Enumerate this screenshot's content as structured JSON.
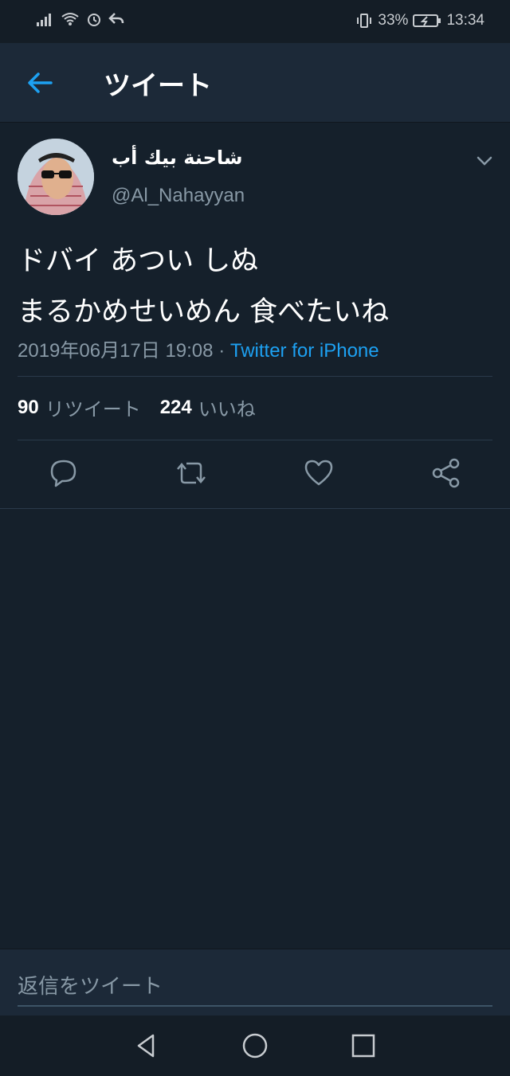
{
  "status_bar": {
    "battery": "33%",
    "time": "13:34"
  },
  "header": {
    "title": "ツイート",
    "back_icon": "arrow-left-icon"
  },
  "tweet": {
    "display_name": "شاحنة بيك أب",
    "screen_name": "@Al_Nahayyan",
    "text_line1": "ドバイ あつい しぬ",
    "text_line2": "まるかめせいめん 食べたいね",
    "timestamp": "2019年06月17日 19:08",
    "separator": "·",
    "source": "Twitter for iPhone",
    "retweets_count": "90",
    "retweets_label": "リツイート",
    "likes_count": "224",
    "likes_label": "いいね"
  },
  "actions": [
    "reply-icon",
    "retweet-icon",
    "like-icon",
    "share-icon"
  ],
  "reply": {
    "placeholder": "返信をツイート"
  },
  "colors": {
    "background": "#15202b",
    "header": "#1c2938",
    "accent": "#1da1f2",
    "muted": "#8899a6"
  }
}
